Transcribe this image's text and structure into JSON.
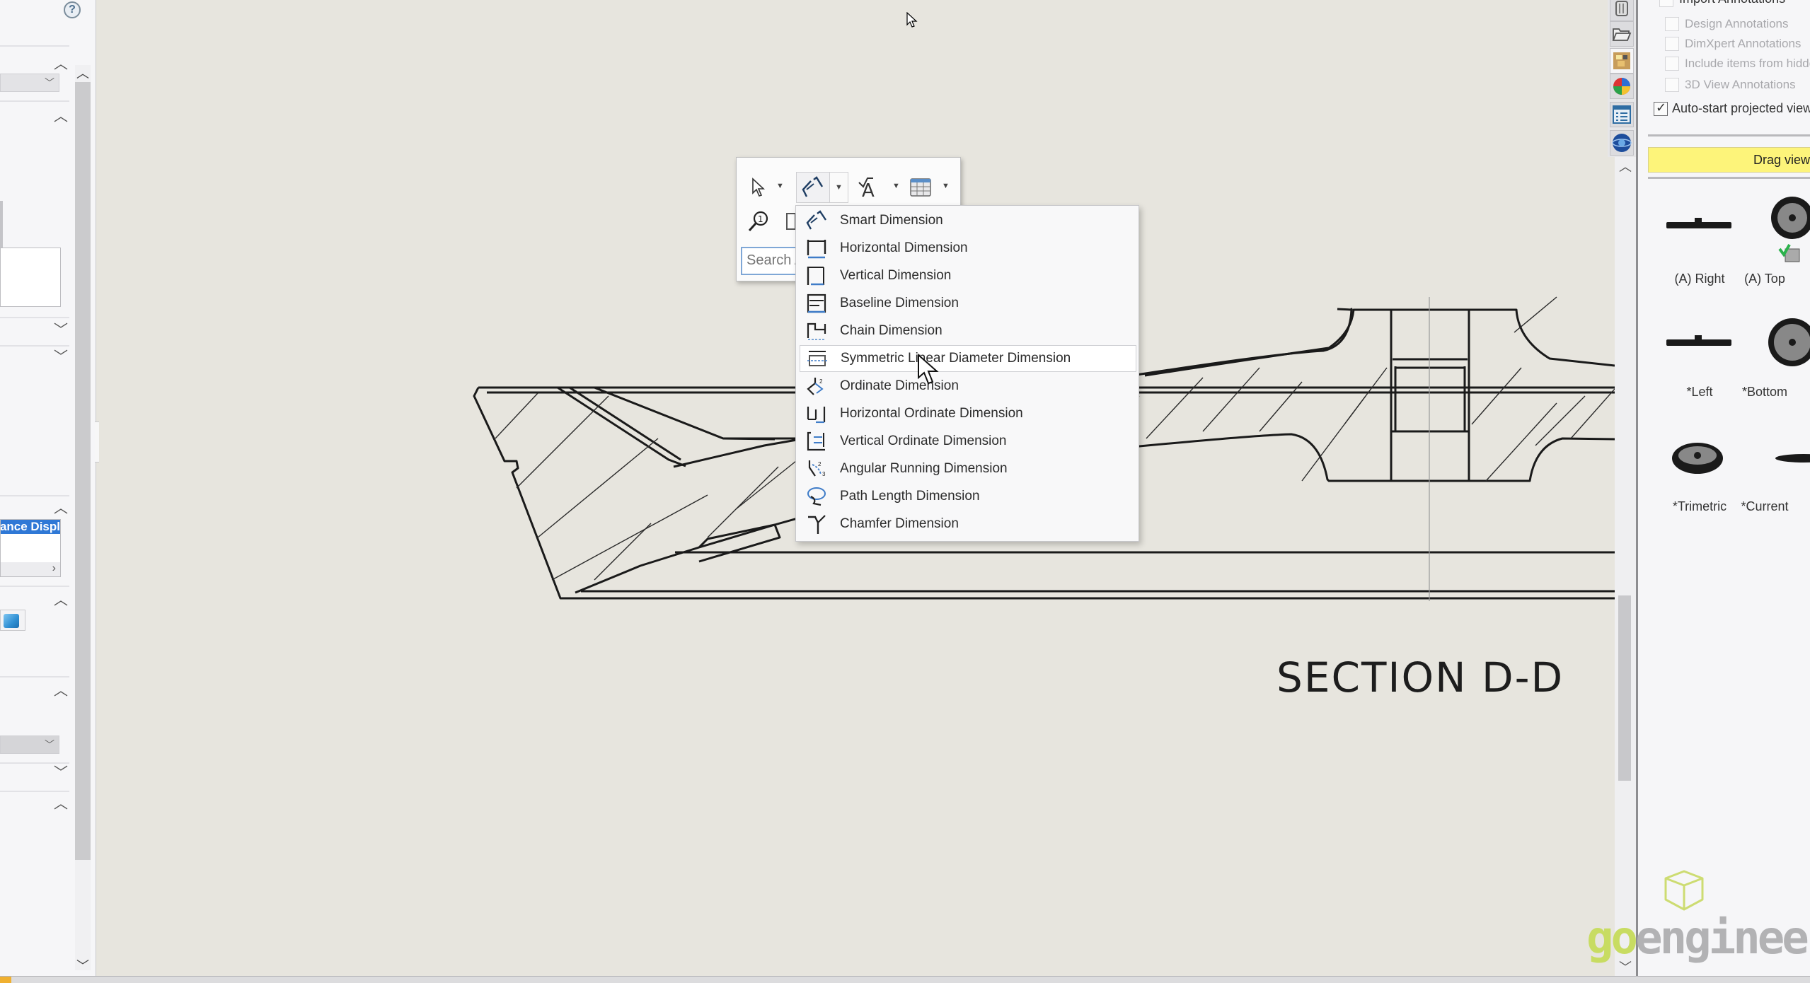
{
  "left_panel": {
    "help_icon": "?",
    "selected_item_text": "Appearance Displ",
    "scroll_right_icon": "›"
  },
  "canvas": {
    "section_label": "SECTION D-D"
  },
  "context_toolbar": {
    "buttons": [
      {
        "name": "select",
        "icon": "pointer-arrow-icon"
      },
      {
        "name": "smart-dimension",
        "icon": "smart-dimension-icon",
        "pressed": true
      },
      {
        "name": "annotation",
        "icon": "note-text-icon"
      },
      {
        "name": "table",
        "icon": "table-icon"
      },
      {
        "name": "balloon",
        "icon": "magnifier-balloon-icon"
      }
    ],
    "search_placeholder": "Search Annotations",
    "search_visible_text": "Search A"
  },
  "dimension_menu": {
    "items": [
      {
        "label": "Smart Dimension",
        "icon": "smart-dimension-icon"
      },
      {
        "label": "Horizontal Dimension",
        "icon": "horizontal-dimension-icon"
      },
      {
        "label": "Vertical Dimension",
        "icon": "vertical-dimension-icon"
      },
      {
        "label": "Baseline Dimension",
        "icon": "baseline-dimension-icon"
      },
      {
        "label": "Chain Dimension",
        "icon": "chain-dimension-icon"
      },
      {
        "label": "Symmetric Linear Diameter Dimension",
        "icon": "symmetric-linear-diameter-icon",
        "hovered": true
      },
      {
        "label": "Ordinate Dimension",
        "icon": "ordinate-dimension-icon"
      },
      {
        "label": "Horizontal Ordinate Dimension",
        "icon": "horizontal-ordinate-icon"
      },
      {
        "label": "Vertical Ordinate Dimension",
        "icon": "vertical-ordinate-icon"
      },
      {
        "label": "Angular Running Dimension",
        "icon": "angular-running-icon"
      },
      {
        "label": "Path Length Dimension",
        "icon": "path-length-icon"
      },
      {
        "label": "Chamfer Dimension",
        "icon": "chamfer-dimension-icon"
      }
    ]
  },
  "task_tabs": [
    {
      "name": "3d-content-central",
      "icon": "library-icon"
    },
    {
      "name": "file-explorer",
      "icon": "folder-icon"
    },
    {
      "name": "view-palette",
      "icon": "view-palette-icon",
      "active": true
    },
    {
      "name": "appearances",
      "icon": "appearances-ball-icon"
    },
    {
      "name": "custom-properties",
      "icon": "properties-list-icon"
    },
    {
      "name": "solidworks-forum",
      "icon": "globe-icon"
    }
  ],
  "right_panel": {
    "import_annotations_label": "Import Annotations",
    "options": [
      {
        "label": "Design Annotations",
        "checked": false,
        "enabled": false
      },
      {
        "label": "DimXpert Annotations",
        "checked": false,
        "enabled": false
      },
      {
        "label": "Include items from hidden features",
        "checked": false,
        "enabled": false
      },
      {
        "label": "3D View Annotations",
        "checked": false,
        "enabled": false
      }
    ],
    "auto_start": {
      "label": "Auto-start projected view",
      "checked": true
    },
    "drag_bar_label": "Drag views onto drawing sheet",
    "views": [
      {
        "label": "(A) Right",
        "shape": "flat"
      },
      {
        "label": "(A) Top",
        "shape": "disc",
        "badge": "used-in-drawing"
      },
      {
        "label": "*Left",
        "shape": "flat"
      },
      {
        "label": "*Bottom",
        "shape": "disc"
      },
      {
        "label": "*Trimetric",
        "shape": "ellipse"
      },
      {
        "label": "*Current",
        "shape": "flat"
      }
    ]
  },
  "watermark": {
    "brand_go": "go",
    "brand_rest": "engineer"
  },
  "colors": {
    "canvas_bg": "#e7e5de",
    "selection_blue": "#2f78d6",
    "drag_bar_yellow": "#fdf47a",
    "brand_green": "#c8dc62"
  }
}
